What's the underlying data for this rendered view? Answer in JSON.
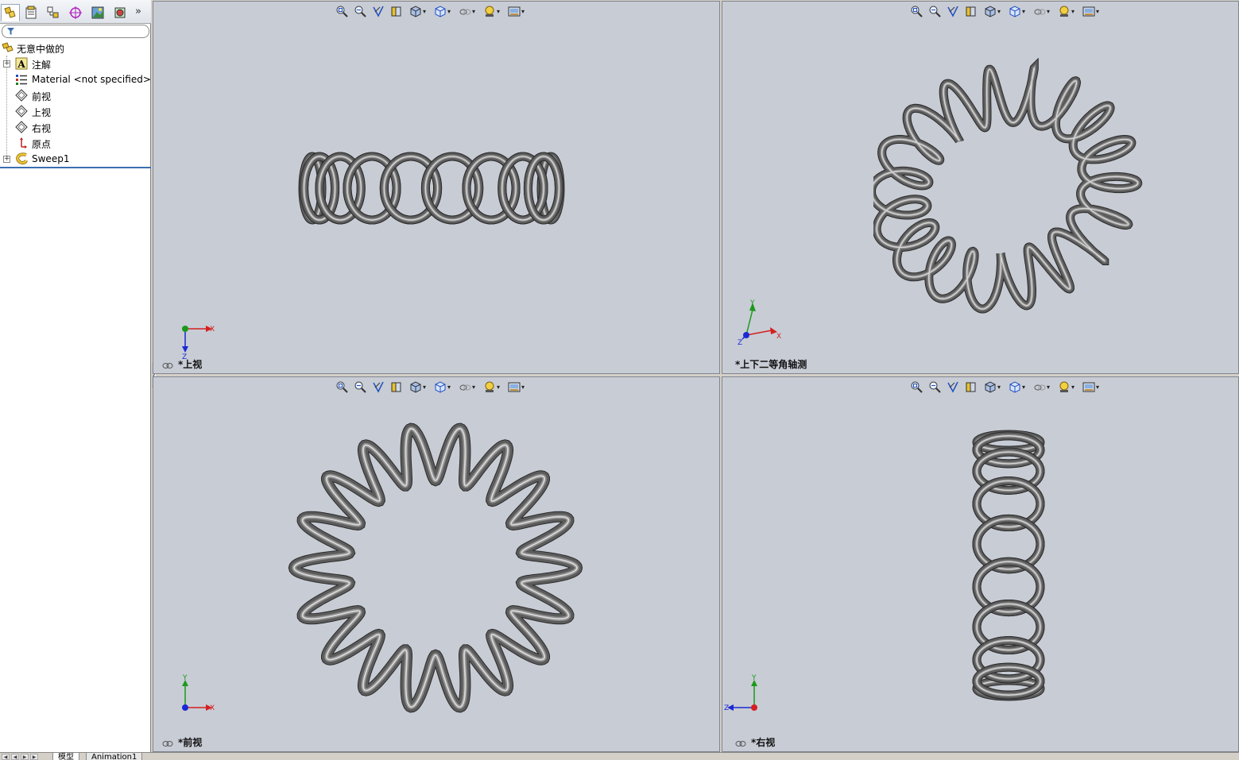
{
  "feature_tree": {
    "filter_placeholder": "",
    "items": [
      {
        "label": "无意中做的",
        "type": "part"
      },
      {
        "label": "注解",
        "type": "annotations",
        "expandable": true
      },
      {
        "label": "Material <not specified>",
        "type": "material"
      },
      {
        "label": "前视",
        "type": "plane"
      },
      {
        "label": "上视",
        "type": "plane"
      },
      {
        "label": "右视",
        "type": "plane"
      },
      {
        "label": "原点",
        "type": "origin"
      },
      {
        "label": "Sweep1",
        "type": "feature",
        "expandable": true
      }
    ],
    "tabs": [
      "featuremanager-icon",
      "propertymanager-icon",
      "configurationmanager-icon",
      "dimxpert-icon",
      "display-manager-icon",
      "appearance-icon"
    ]
  },
  "viewports": {
    "top_left": {
      "label": "*上视",
      "triad": [
        "X",
        "Z"
      ]
    },
    "top_right": {
      "label": "*上下二等角轴测",
      "triad": [
        "Y",
        "X",
        "Z"
      ]
    },
    "bottom_left": {
      "label": "*前视",
      "triad": [
        "Y",
        "X"
      ]
    },
    "bottom_right": {
      "label": "*右视",
      "triad": [
        "Y",
        "Z"
      ]
    }
  },
  "view_toolbar_icons": [
    "zoom-to-fit-icon",
    "zoom-to-area-icon",
    "previous-view-icon",
    "section-view-icon",
    "view-orientation-icon",
    "display-style-icon",
    "hide-show-icon",
    "edit-appearance-icon",
    "apply-scene-icon"
  ],
  "bottom_tabs": {
    "model": "模型",
    "animation": "Animation1"
  },
  "colors": {
    "viewport_bg": "#c8ccd5",
    "axis_x": "#d42020",
    "axis_y": "#1a9a1a",
    "axis_z": "#1a2ad4",
    "spring": "#5c5c5c"
  }
}
